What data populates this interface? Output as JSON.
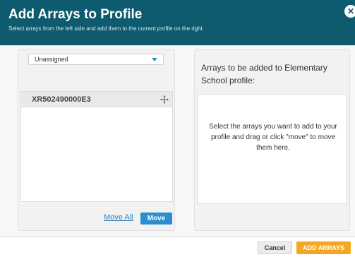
{
  "dialog": {
    "title": "Add Arrays to Profile",
    "subtitle": "Select arrays from the left side and add them to the current profile on the right.",
    "close_icon": "close-icon"
  },
  "left_panel": {
    "filter": {
      "selected": "Unassigned",
      "icon": "chevron-down-icon"
    },
    "arrays": [
      {
        "label": "XR502490000E3",
        "icon": "move-icon"
      }
    ],
    "move_all_label": "Move All",
    "move_label": "Move"
  },
  "right_panel": {
    "heading": "Arrays to be added to Elementary School profile:",
    "hint": "Select the arrays you want to add to your profile and drag or click \"move\" to move them here."
  },
  "footer": {
    "cancel_label": "Cancel",
    "add_label": "ADD ARRAYS"
  },
  "colors": {
    "header": "#0e5a6e",
    "move_button": "#2a8fd0",
    "add_button": "#f5a623"
  }
}
